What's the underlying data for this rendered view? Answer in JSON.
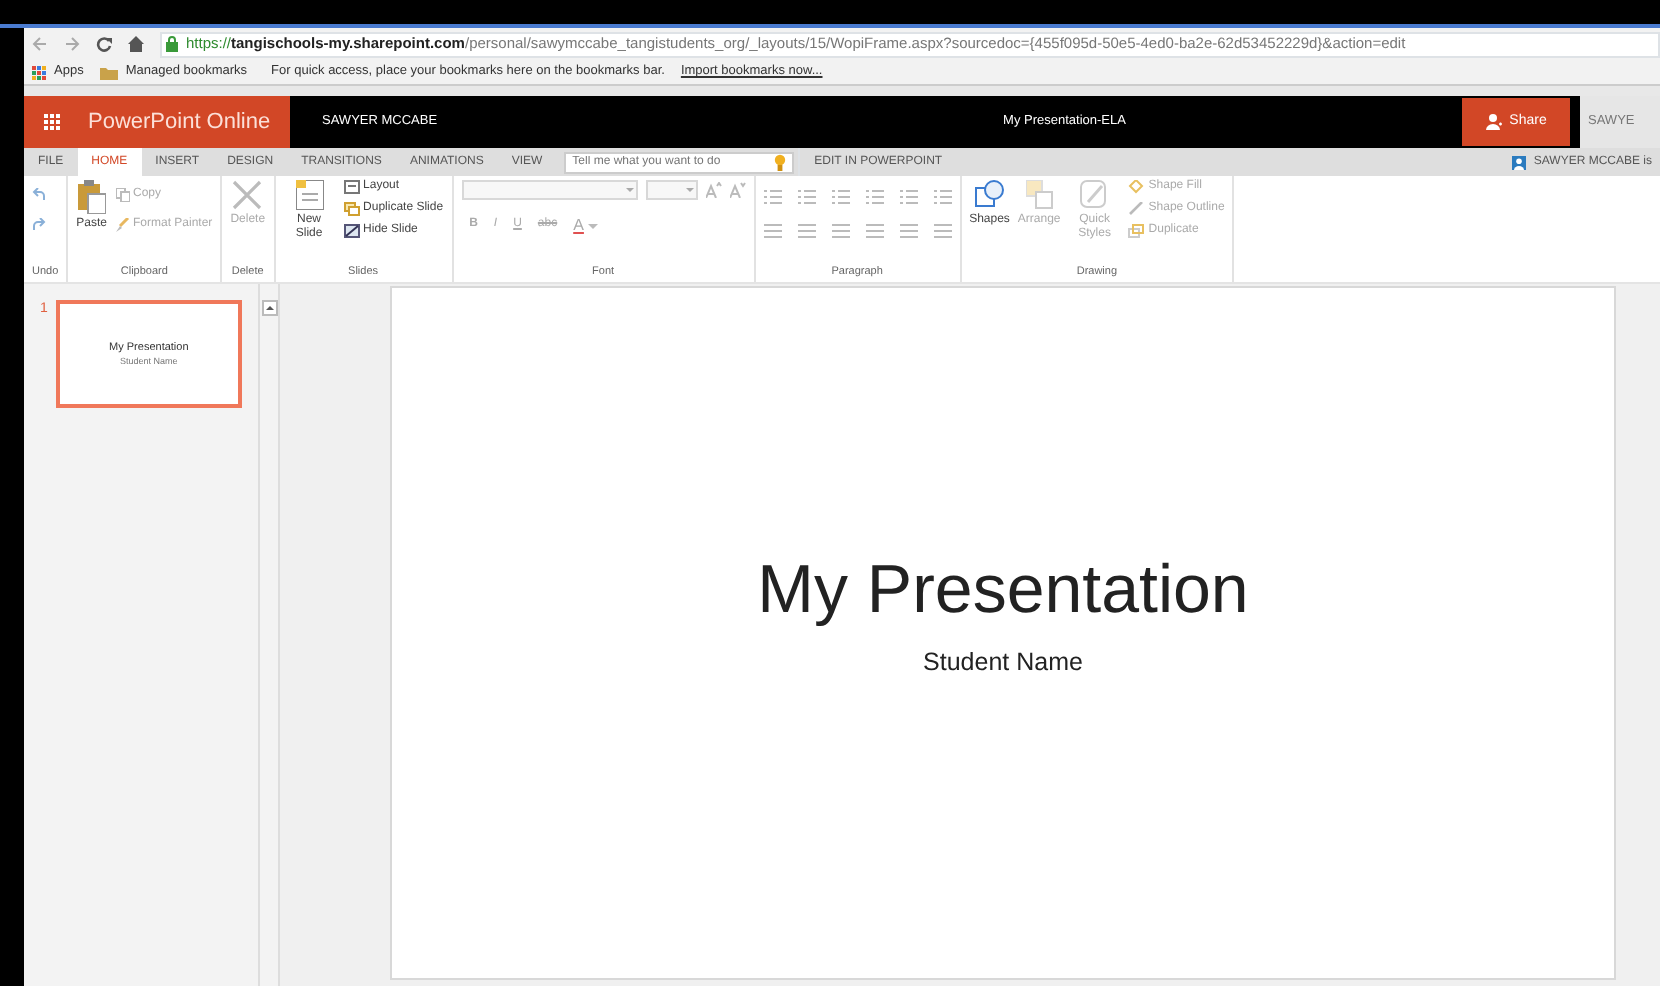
{
  "browser": {
    "url": {
      "scheme": "https://",
      "host": "tangischools-my.sharepoint.com",
      "path": "/personal/sawymccabe_tangistudents_org/_layouts/15/WopiFrame.aspx?sourcedoc={455f095d-50e5-4ed0-ba2e-62d53452229d}&action=edit"
    },
    "bookmarks": [
      {
        "kind": "apps",
        "label": "Apps"
      },
      {
        "kind": "folder",
        "label": "Managed bookmarks"
      }
    ],
    "bookmarks_hint": "For quick access, place your bookmarks here on the bookmarks bar.",
    "bookmarks_link": "Import bookmarks now..."
  },
  "app_bar": {
    "app_name": "PowerPoint Online",
    "user": "SAWYER MCCABE",
    "document_title": "My Presentation-ELA",
    "share_button": "Share",
    "user_cut": "SAWYE"
  },
  "ribbon_tabs": [
    {
      "label": "FILE",
      "selected": false
    },
    {
      "label": "HOME",
      "selected": true
    },
    {
      "label": "INSERT",
      "selected": false
    },
    {
      "label": "DESIGN",
      "selected": false
    },
    {
      "label": "TRANSITIONS",
      "selected": false
    },
    {
      "label": "ANIMATIONS",
      "selected": false
    },
    {
      "label": "VIEW",
      "selected": false
    }
  ],
  "tell_me": {
    "placeholder": "Tell me what you want to do"
  },
  "edit_in": "EDIT IN POWERPOINT",
  "account": "SAWYER MCCABE is",
  "ribbon_groups": [
    {
      "kind": "undo",
      "label": "Undo"
    },
    {
      "kind": "clipboard",
      "label": "Clipboard",
      "commands": [
        {
          "label": "Paste",
          "disabled": false
        },
        {
          "label": "Copy",
          "disabled": true
        },
        {
          "label": "Format Painter",
          "disabled": true
        }
      ]
    },
    {
      "kind": "delete",
      "label": "Delete",
      "commands": [
        {
          "label": "Delete",
          "disabled": true
        }
      ]
    },
    {
      "kind": "slides",
      "label": "Slides",
      "commands": [
        {
          "label": "New Slide",
          "disabled": false
        },
        {
          "label": "Layout",
          "disabled": false
        },
        {
          "label": "Duplicate Slide",
          "disabled": false
        },
        {
          "label": "Hide Slide",
          "disabled": false
        }
      ]
    },
    {
      "kind": "font",
      "label": "Font",
      "commands": [
        {
          "label": "B",
          "disabled": true
        },
        {
          "label": "I",
          "disabled": true
        },
        {
          "label": "U",
          "disabled": true
        },
        {
          "label": "abc",
          "disabled": true
        },
        {
          "label": "A",
          "disabled": true
        }
      ]
    },
    {
      "kind": "paragraph",
      "label": "Paragraph"
    },
    {
      "kind": "drawing",
      "label": "Drawing",
      "commands": [
        {
          "label": "Shapes",
          "disabled": false
        },
        {
          "label": "Arrange",
          "disabled": true
        },
        {
          "label": "Quick Styles",
          "disabled": true
        },
        {
          "label": "Shape Fill",
          "disabled": true
        },
        {
          "label": "Shape Outline",
          "disabled": true
        },
        {
          "label": "Duplicate",
          "disabled": true
        }
      ]
    }
  ],
  "thumbnails": [
    {
      "number": "1",
      "title": "My Presentation",
      "subtitle": "Student Name",
      "selected": true
    }
  ],
  "slide": {
    "title": "My Presentation",
    "subtitle": "Student Name"
  }
}
